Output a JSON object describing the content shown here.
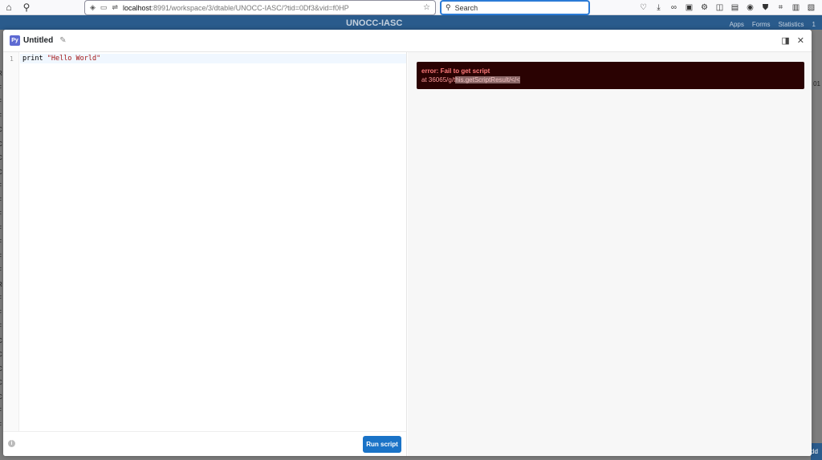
{
  "browser": {
    "url_host": "localhost",
    "url_path": ":8991/workspace/3/dtable/UNOCC-IASC/?tid=0Df3&vid=f0HP",
    "search_placeholder": "Search"
  },
  "app": {
    "title": "UNOCC-IASC",
    "nav": [
      "Apps",
      "Forms",
      "Statistics",
      "1"
    ],
    "right_fragment": "01",
    "add_fragment": "dd",
    "left_letters": [
      "R",
      "F",
      "F",
      "F",
      "C",
      "C",
      "C",
      "C",
      "F",
      "F",
      "F",
      "F",
      "F",
      "F",
      "F",
      "R",
      "F",
      "F",
      "F",
      "C",
      "C",
      "C",
      "C",
      "C",
      "F",
      "F"
    ]
  },
  "modal": {
    "badge": "Py",
    "title": "Untitled",
    "code": {
      "line_number": "1",
      "keyword": "print",
      "string": "\"Hello World\""
    },
    "run_label": "Run script",
    "error": {
      "title": "error: Fail to get script",
      "trace_prefix": "at 36065/g/t",
      "trace_highlight": "his.getScriptResult/</<"
    }
  }
}
